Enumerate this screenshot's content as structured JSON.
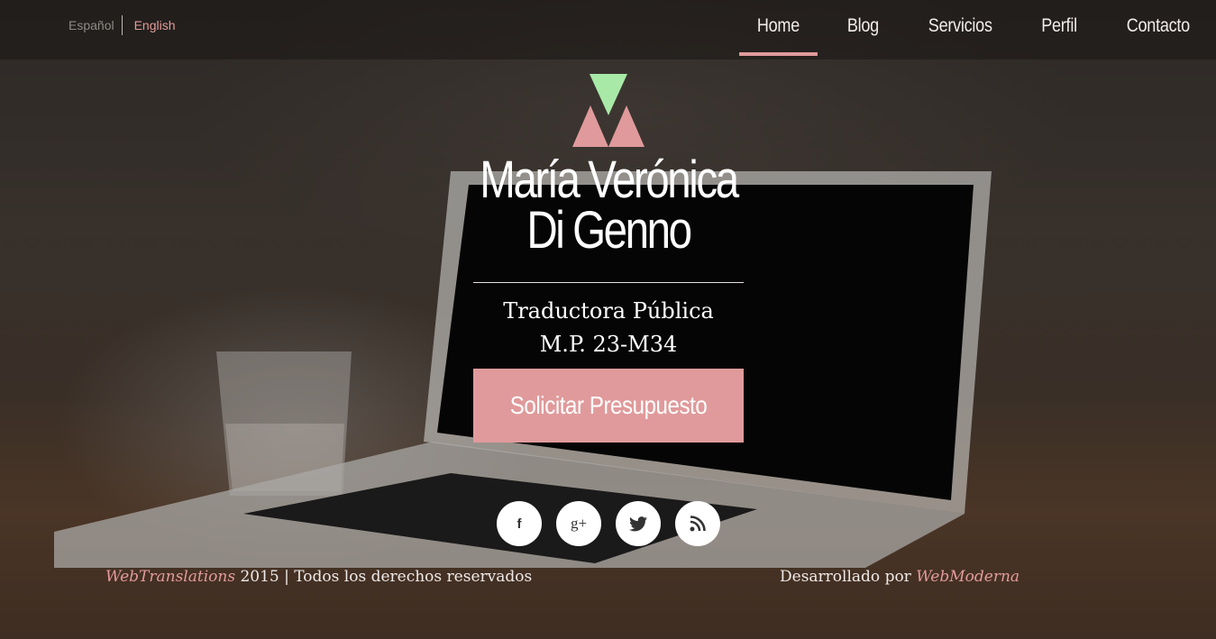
{
  "lang": {
    "es": "Español",
    "en": "English"
  },
  "nav": {
    "items": [
      {
        "label": "Home",
        "active": true
      },
      {
        "label": "Blog"
      },
      {
        "label": "Servicios"
      },
      {
        "label": "Perfil"
      },
      {
        "label": "Contacto"
      }
    ]
  },
  "hero": {
    "name_line1": "María Verónica",
    "name_line2": "Di Genno",
    "subtitle_line1": "Traductora Pública",
    "subtitle_line2": "M.P. 23-M34",
    "cta": "Solicitar Presupuesto"
  },
  "social": {
    "facebook": "f",
    "googleplus": "g+",
    "icons": [
      "facebook-icon",
      "google-plus-icon",
      "twitter-icon",
      "rss-icon"
    ]
  },
  "footer": {
    "brand": "WebTranslations",
    "year_rights": "2015 | Todos los derechos reservados",
    "developed_by": "Desarrollado por",
    "developer": "WebModerna"
  },
  "colors": {
    "accent": "#e09a9b",
    "logo_green": "#a8e9a8",
    "text": "#ffffff"
  }
}
